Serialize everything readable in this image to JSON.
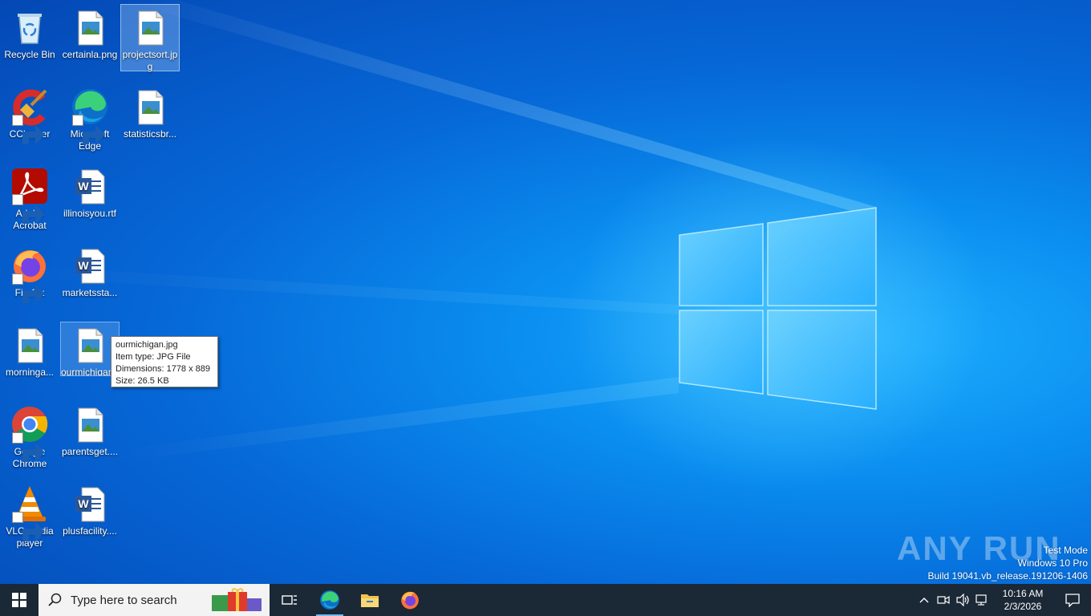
{
  "desktop_icons": [
    {
      "label": "Recycle Bin",
      "icon": "recycle-bin-icon"
    },
    {
      "label": "certainla.png",
      "icon": "image-file-icon"
    },
    {
      "label": "projectsort.jpg",
      "icon": "image-file-icon"
    },
    {
      "label": "CCleaner",
      "icon": "ccleaner-icon"
    },
    {
      "label": "Microsoft Edge",
      "icon": "edge-icon"
    },
    {
      "label": "statisticsbr...",
      "icon": "image-file-icon"
    },
    {
      "label": "Adobe Acrobat",
      "icon": "acrobat-icon"
    },
    {
      "label": "illinoisyou.rtf",
      "icon": "word-doc-icon"
    },
    {
      "label": "Firefox",
      "icon": "firefox-icon"
    },
    {
      "label": "marketssta...",
      "icon": "word-doc-icon"
    },
    {
      "label": "morninga...",
      "icon": "image-file-icon"
    },
    {
      "label": "ourmichigan.jpg",
      "icon": "image-file-icon"
    },
    {
      "label": "Google Chrome",
      "icon": "chrome-icon"
    },
    {
      "label": "parentsget....",
      "icon": "image-file-icon"
    },
    {
      "label": "VLC media player",
      "icon": "vlc-icon"
    },
    {
      "label": "plusfacility....",
      "icon": "word-doc-icon"
    }
  ],
  "tooltip": {
    "name": "ourmichigan.jpg",
    "type": "Item type: JPG File",
    "dimensions": "Dimensions: 1778 x 889",
    "size": "Size: 26.5 KB"
  },
  "watermark": {
    "brand": "ANY RUN",
    "line1": "Test Mode",
    "line2": "Windows 10 Pro",
    "line3": "Build 19041.vb_release.191206-1406"
  },
  "taskbar": {
    "search_placeholder": "Type here to search",
    "clock_time": "10:16 AM",
    "clock_date": "2/3/2026"
  },
  "colors": {
    "taskbar": "#1b2836",
    "desktop_accent": "#0a8ef0"
  }
}
